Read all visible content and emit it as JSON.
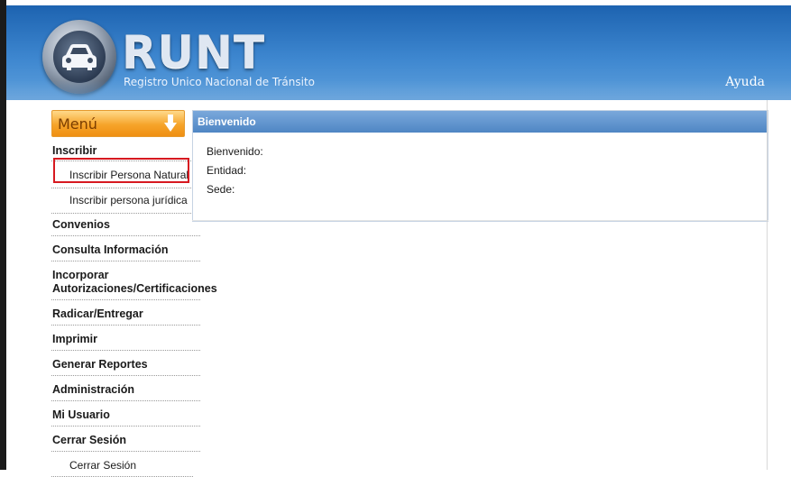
{
  "header": {
    "brand": "RUNT",
    "subtitle": "Registro Unico Nacional de Tránsito",
    "help_label": "Ayuda"
  },
  "sidebar": {
    "menu_title": "Menú",
    "items": [
      {
        "label": "Inscribir",
        "children": [
          "Inscribir Persona Natural",
          "Inscribir persona jurídica"
        ]
      },
      {
        "label": "Convenios"
      },
      {
        "label": "Consulta Información"
      },
      {
        "label": "Incorporar\nAutorizaciones/Certificaciones"
      },
      {
        "label": "Radicar/Entregar"
      },
      {
        "label": "Imprimir"
      },
      {
        "label": "Generar Reportes"
      },
      {
        "label": "Administración"
      },
      {
        "label": "Mi Usuario"
      },
      {
        "label": "Cerrar Sesión",
        "children": [
          "Cerrar Sesión"
        ]
      }
    ]
  },
  "main": {
    "panel_title": "Bienvenido",
    "fields": [
      {
        "label": "Bienvenido:",
        "value": ""
      },
      {
        "label": "Entidad:",
        "value": ""
      },
      {
        "label": "Sede:",
        "value": ""
      }
    ]
  },
  "colors": {
    "header_blue": "#3d86cf",
    "menu_orange": "#f6a42a",
    "panel_header_blue": "#5b8fcb",
    "highlight_red": "#d71920"
  },
  "icons": {
    "logo": "car-logo-icon",
    "menu_toggle": "arrow-down-icon"
  }
}
